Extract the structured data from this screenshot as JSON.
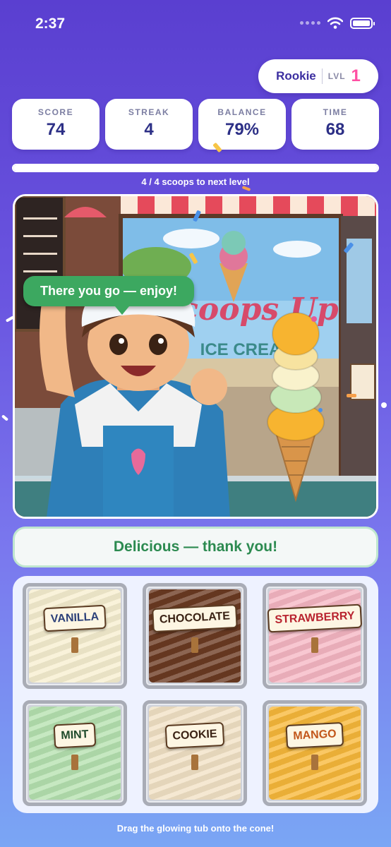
{
  "status_bar": {
    "time": "2:37"
  },
  "header": {
    "rank": "Rookie",
    "level_label": "LVL",
    "level": "1"
  },
  "stats": [
    {
      "label": "SCORE",
      "value": "74"
    },
    {
      "label": "STREAK",
      "value": "4"
    },
    {
      "label": "BALANCE",
      "value": "79%"
    },
    {
      "label": "TIME",
      "value": "68"
    }
  ],
  "progress": {
    "text": "4 / 4 scoops to next level",
    "fraction": 1.0
  },
  "scene": {
    "speech": "There you go — enjoy!",
    "scoop_colors": [
      "#f7b430",
      "#c8e8b8",
      "#f9f2cc",
      "#f7e3a0",
      "#f7b430"
    ]
  },
  "message": "Delicious — thank you!",
  "tubs": [
    {
      "label": "VANILLA",
      "color": "#f7efd0",
      "text_color": "#2b3f78"
    },
    {
      "label": "CHOCOLATE",
      "color": "#6b3a22",
      "text_color": "#3a2214"
    },
    {
      "label": "STRAWBERRY",
      "color": "#f6b7c4",
      "text_color": "#b8222e"
    },
    {
      "label": "MINT",
      "color": "#b6e2b0",
      "text_color": "#1e4a2a"
    },
    {
      "label": "COOKIE",
      "color": "#f2e2c6",
      "text_color": "#3a2214"
    },
    {
      "label": "MANGO",
      "color": "#f8b93a",
      "text_color": "#c2561a"
    }
  ],
  "hint": "Drag the glowing tub onto the cone!"
}
